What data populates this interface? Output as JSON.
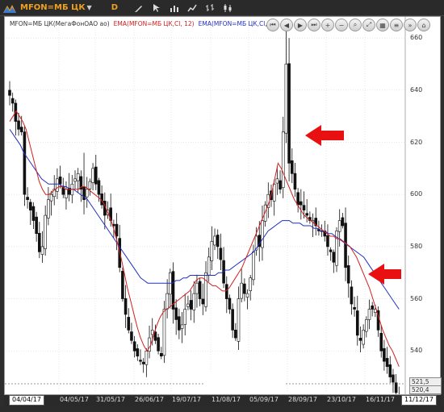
{
  "toolbar": {
    "ticker": "MFON=МБ ЦК",
    "dropdown_symbol": "▼",
    "period": "D",
    "tool_icons": [
      "pencil-icon",
      "cursor-icon",
      "histogram-icon",
      "line-chart-icon",
      "bar-chart-icon",
      "candlestick-icon"
    ]
  },
  "legend": {
    "main": "MFON=МБ ЦК(МегаФонОАО ао)",
    "ema12": "EMA(MFON=МБ ЦК,Cl, 12)",
    "ema48": "EMA(MFON=МБ ЦК,Cl, 48)"
  },
  "nav_buttons": [
    "first-icon",
    "prev-icon",
    "play-icon",
    "next-icon",
    "zoom-in-icon",
    "zoom-out-icon",
    "search-zoom-icon",
    "fit-icon",
    "grid-icon",
    "properties-icon",
    "chevrons-icon",
    "home-icon"
  ],
  "colors": {
    "ema12": "#d42020",
    "ema48": "#2030c0",
    "candles": "#111111",
    "arrows": "#e81010"
  },
  "price_labels": {
    "last_close": "521,5",
    "last_ref": "520,4"
  },
  "chart_data": {
    "type": "candlestick",
    "yticks": [
      540,
      560,
      580,
      600,
      620,
      640,
      660
    ],
    "ylim": [
      524,
      665
    ],
    "xticks": [
      "04/04/17",
      "04/05/17",
      "31/05/17",
      "26/06/17",
      "19/07/17",
      "11/08/17",
      "05/09/17",
      "28/09/17",
      "23/10/17",
      "16/11/17",
      "11/12/17"
    ],
    "grid": true,
    "series": [
      {
        "name": "MFON=МБ ЦК(МегаФонОАО ао)",
        "kind": "ohlc"
      },
      {
        "name": "EMA(MFON=МБ ЦК,Cl, 12)",
        "kind": "line"
      },
      {
        "name": "EMA(MFON=МБ ЦК,Cl, 48)",
        "kind": "line"
      }
    ],
    "close": [
      638,
      635,
      628,
      625,
      624,
      600,
      598,
      594,
      590,
      585,
      578,
      580,
      592,
      598,
      600,
      602,
      606,
      604,
      600,
      602,
      600,
      604,
      606,
      608,
      602,
      598,
      602,
      605,
      610,
      604,
      600,
      596,
      592,
      594,
      590,
      588,
      584,
      572,
      560,
      554,
      548,
      544,
      540,
      538,
      536,
      535,
      540,
      545,
      548,
      544,
      540,
      538,
      556,
      562,
      570,
      556,
      552,
      548,
      550,
      556,
      558,
      556,
      562,
      566,
      560,
      558,
      570,
      576,
      582,
      584,
      580,
      575,
      566,
      560,
      556,
      548,
      545,
      560,
      566,
      562,
      562,
      568,
      578,
      584,
      580,
      590,
      596,
      600,
      598,
      604,
      606,
      602,
      624,
      650,
      612,
      608,
      602,
      596,
      596,
      594,
      592,
      590,
      590,
      588,
      586,
      586,
      584,
      580,
      578,
      574,
      586,
      590,
      588,
      572,
      566,
      558,
      556,
      546,
      544,
      548,
      552,
      556,
      556,
      556,
      548,
      540,
      536,
      534,
      530,
      528,
      524,
      522
    ],
    "ema12": [
      628,
      630,
      632,
      630,
      628,
      625,
      620,
      615,
      610,
      605,
      602,
      600,
      600,
      601,
      602,
      603,
      603,
      602,
      602,
      602,
      602,
      602,
      603,
      603,
      602,
      601,
      600,
      599,
      598,
      596,
      593,
      590,
      586,
      581,
      576,
      570,
      564,
      559,
      554,
      549,
      545,
      542,
      540,
      542,
      546,
      550,
      553,
      555,
      556,
      557,
      558,
      559,
      560,
      561,
      562,
      563,
      565,
      567,
      568,
      568,
      567,
      566,
      565,
      565,
      564,
      563,
      563,
      564,
      566,
      568,
      570,
      572,
      575,
      578,
      581,
      584,
      587,
      590,
      593,
      596,
      600,
      606,
      612,
      610,
      607,
      604,
      601,
      598,
      596,
      594,
      592,
      591,
      590,
      589,
      588,
      587,
      586,
      585,
      584,
      584,
      583,
      583,
      582,
      581,
      580,
      578,
      576,
      573,
      570,
      567,
      564,
      560,
      556,
      552,
      548,
      545,
      542,
      540,
      537,
      534
    ],
    "ema48": [
      625,
      623,
      621,
      619,
      616,
      614,
      612,
      610,
      608,
      606,
      605,
      604,
      604,
      604,
      604,
      603,
      603,
      602,
      602,
      601,
      600,
      599,
      598,
      596,
      594,
      592,
      590,
      588,
      586,
      584,
      582,
      580,
      578,
      576,
      574,
      572,
      570,
      568,
      567,
      566,
      566,
      566,
      566,
      566,
      566,
      566,
      566,
      567,
      567,
      568,
      568,
      569,
      569,
      569,
      569,
      569,
      569,
      569,
      569,
      570,
      570,
      571,
      571,
      572,
      573,
      574,
      575,
      576,
      577,
      578,
      580,
      582,
      584,
      586,
      587,
      588,
      589,
      590,
      590,
      590,
      589,
      589,
      589,
      588,
      588,
      588,
      587,
      587,
      586,
      586,
      585,
      585,
      584,
      583,
      582,
      581,
      580,
      579,
      578,
      577,
      576,
      574,
      572,
      570,
      568,
      566,
      564,
      562,
      560,
      558,
      556
    ]
  }
}
